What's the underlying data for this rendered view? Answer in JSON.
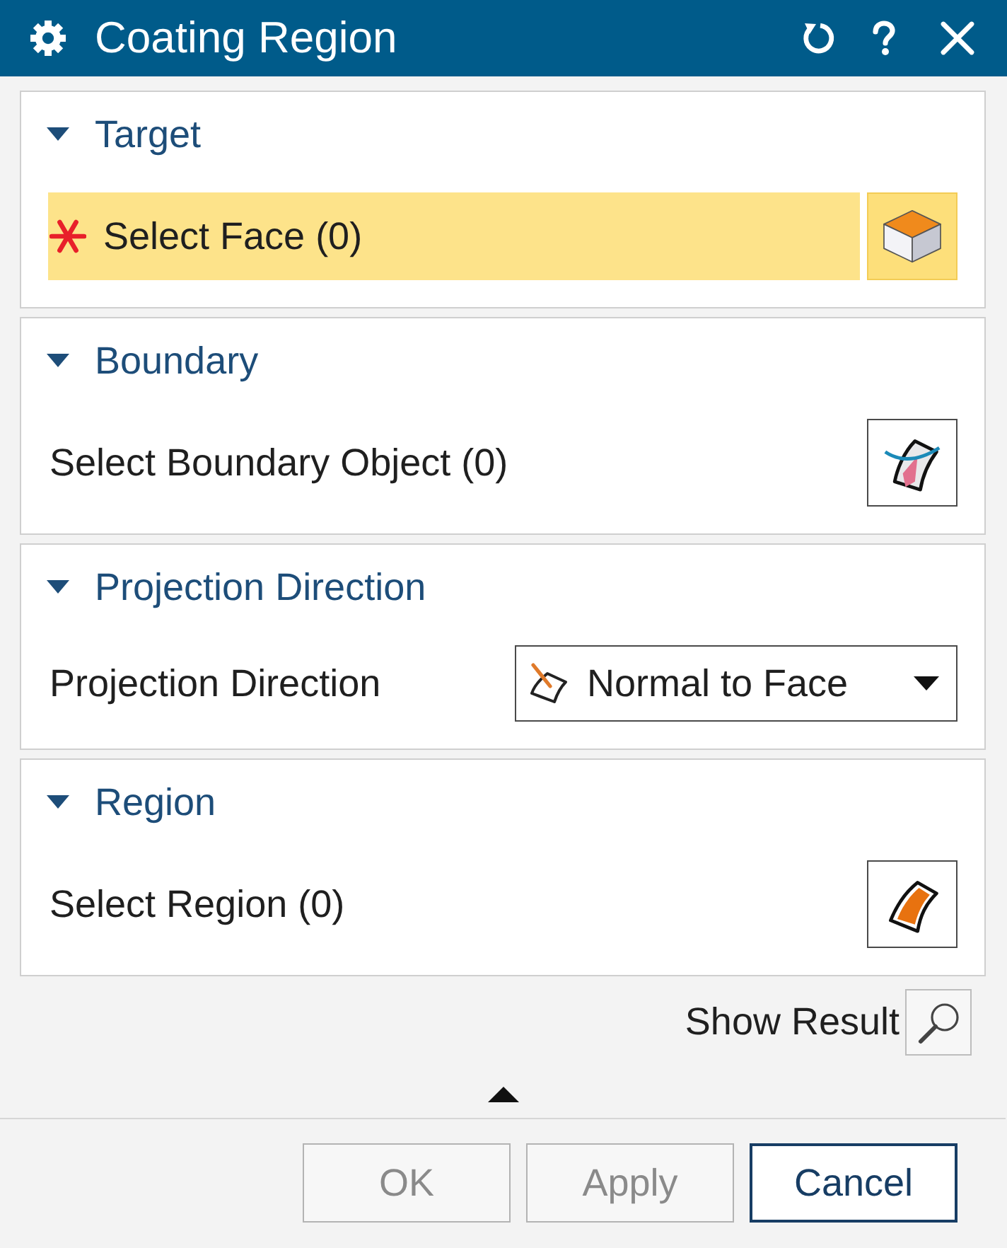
{
  "window": {
    "title": "Coating Region"
  },
  "groups": [
    {
      "title": "Target",
      "expanded": true,
      "rows": [
        {
          "kind": "face",
          "label": "Select Face (0)",
          "required": true,
          "active": true
        }
      ]
    },
    {
      "title": "Boundary",
      "expanded": true,
      "rows": [
        {
          "kind": "boundary",
          "label": "Select Boundary Object (0)",
          "required": false,
          "active": false
        }
      ]
    },
    {
      "title": "Projection Direction",
      "expanded": true,
      "rows": [
        {
          "kind": "dropdown",
          "label": "Projection Direction",
          "value": "Normal to Face"
        }
      ]
    },
    {
      "title": "Region",
      "expanded": true,
      "rows": [
        {
          "kind": "region",
          "label": "Select Region (0)",
          "required": false,
          "active": false
        }
      ]
    }
  ],
  "preview": {
    "label": "Show Result"
  },
  "buttons": [
    {
      "label": "OK",
      "disabled": true,
      "focused": false
    },
    {
      "label": "Apply",
      "disabled": true,
      "focused": false
    },
    {
      "label": "Cancel",
      "disabled": false,
      "focused": true
    }
  ]
}
